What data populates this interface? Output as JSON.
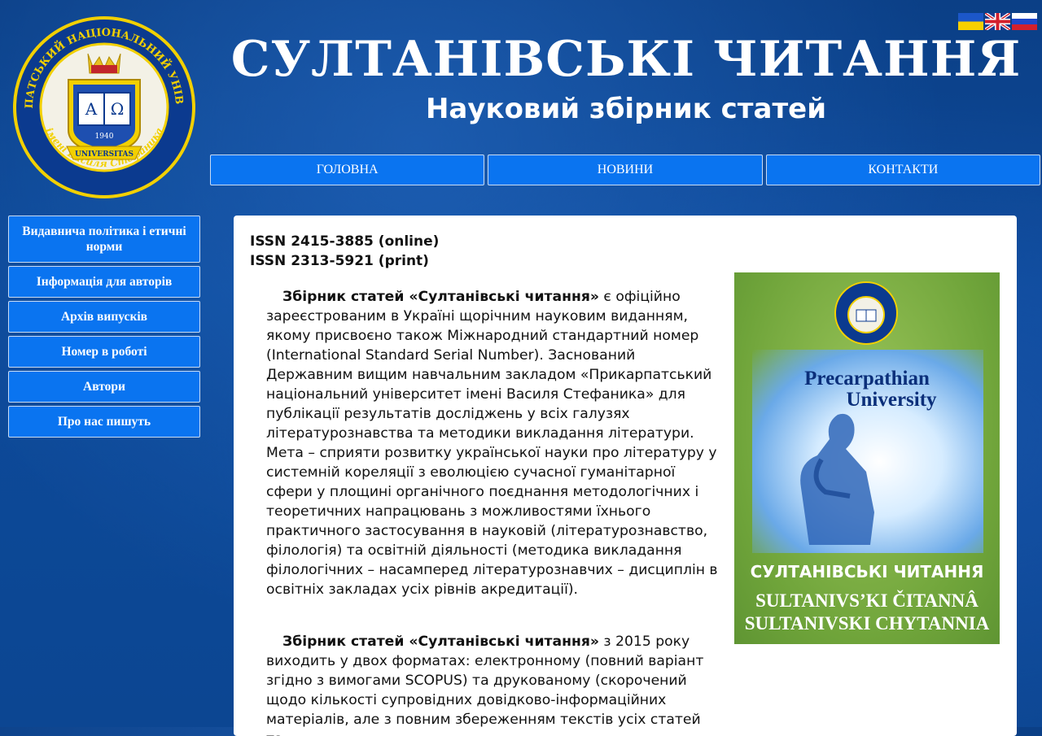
{
  "header": {
    "title": "СУЛТАНІВСЬКІ ЧИТАННЯ",
    "subtitle": "Науковий збірник статей",
    "logo": {
      "ring_text": "ПРИКАРПАТСЬКИЙ НАЦІОНАЛЬНИЙ УНІВЕРСИТЕТ",
      "bottom_text": "імені Василя Стефаника",
      "book_left": "Α",
      "book_right": "Ω",
      "year": "1940",
      "ribbon": "UNIVERSITAS"
    },
    "flags": [
      "flag-ukraine-icon",
      "flag-uk-icon",
      "flag-russia-icon"
    ]
  },
  "topnav": [
    {
      "label": "ГОЛОВНА"
    },
    {
      "label": "НОВИНИ"
    },
    {
      "label": "КОНТАКТИ"
    }
  ],
  "sidebar": [
    {
      "label": "Видавнича політика і етичні норми"
    },
    {
      "label": "Інформація для авторів"
    },
    {
      "label": "Архів випусків"
    },
    {
      "label": "Номер в роботі"
    },
    {
      "label": "Автори"
    },
    {
      "label": "Про нас пишуть"
    }
  ],
  "main": {
    "issn_online": "ISSN 2415-3885 (online)",
    "issn_print": "ISSN 2313-5921 (print)",
    "para1_bold": "Збірник статей «Султанівські читання»",
    "para1_text": " є офіційно зареєстрованим в Україні щорічним науковим виданням, якому присвоєно також Міжнародний стандартний номер (International Standard Serial Number). Заснований Державним вищим навчальним закладом «Прикарпатський національний університет імені Василя Стефаника» для публікації результатів досліджень у всіх галузях літературознавства та методики викладання літератури. Мета – сприяти розвитку української науки про літературу у системній кореляції з еволюцією сучасної гуманітарної сфери у площині органічного поєднання методологічних і теоретичних напрацювань з можливостями їхнього практичного застосування в науковій (літературознавство, філологія) та освітній діяльності (методика викладання філологічних – насамперед літературознавчих – дисциплін в освітніх закладах усіх рівнів акредитації).",
    "para2_bold": "Збірник статей «Султанівські читання»",
    "para2_text": " з 2015 року виходить у двох форматах: електронному (повний варіант згідно з вимогами SCOPUS) та друкованому (скорочений щодо кількості супровідних довідково-інформаційних матеріалів, але з повним збереженням текстів усіх статей та",
    "cover": {
      "university": "Precarpathian University",
      "university_line1": "Precarpathian",
      "university_line2": "University",
      "title_ua": "СУЛТАНІВСЬКІ ЧИТАННЯ",
      "title_lat1": "SULTANIVS’KI ČITANNÂ",
      "title_lat2": "SULTANIVSKI CHYTANNIA"
    }
  },
  "colors": {
    "nav_button": "#0a74f0",
    "background": "#0d4a9a",
    "logo_gold": "#f2d000",
    "logo_blue": "#0b3a8f"
  }
}
